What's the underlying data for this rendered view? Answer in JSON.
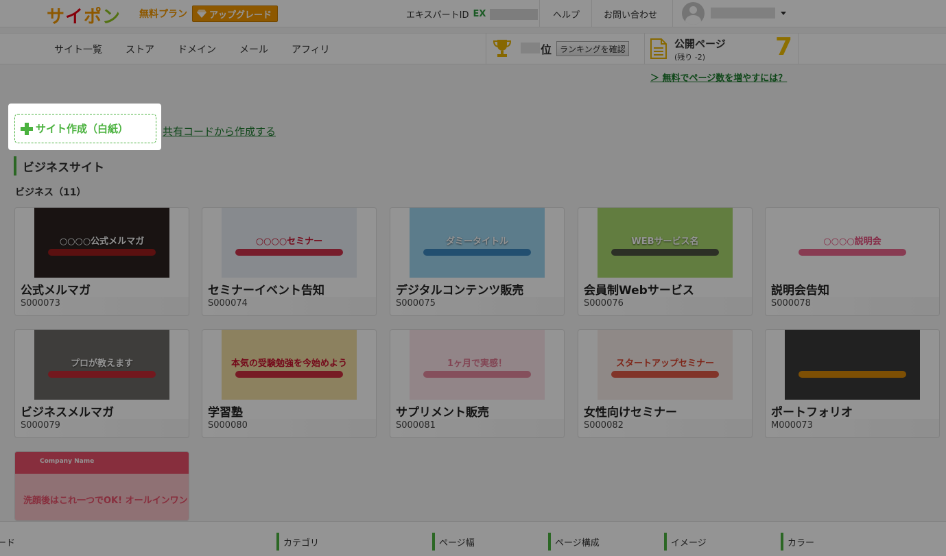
{
  "header": {
    "logo_parts": [
      "サ",
      "イ",
      "ポ",
      "ン"
    ],
    "plan": "無料プラン",
    "upgrade_label": "アップグレード",
    "expert_label": "エキスパートID",
    "expert_prefix": "EX",
    "help": "ヘルプ",
    "contact": "お問い合わせ"
  },
  "nav": {
    "items": [
      "サイト一覧",
      "ストア",
      "ドメイン",
      "メール",
      "アフィリ"
    ]
  },
  "ranking": {
    "suffix": "位",
    "button": "ランキングを確認"
  },
  "public_pages": {
    "title": "公開ページ",
    "remaining": "(残り -2)",
    "count": "7",
    "increase_link": "＞ 無料でページ数を増やすには？"
  },
  "create": {
    "blank_button": "サイト作成（白紙）",
    "shared_link": "共有コードから作成する"
  },
  "section": {
    "title": "ビジネスサイト",
    "category": "ビジネス（11）"
  },
  "templates": [
    {
      "name": "公式メルマガ",
      "code": "S000073",
      "thumb_text": "○○○○公式メルマガ",
      "bg": "#2b2220",
      "accent": "#b21c1c"
    },
    {
      "name": "セミナーイベント告知",
      "code": "S000074",
      "thumb_text": "○○○○セミナー",
      "bg": "#e9eef4",
      "accent": "#c8102e"
    },
    {
      "name": "デジタルコンテンツ販売",
      "code": "S000075",
      "thumb_text": "ダミータイトル",
      "bg": "#9fd6f0",
      "accent": "#2a7ab8"
    },
    {
      "name": "会員制Webサービス",
      "code": "S000076",
      "thumb_text": "WEBサービス名",
      "bg": "#a9d86e",
      "accent": "#3c3c3c"
    },
    {
      "name": "説明会告知",
      "code": "S000078",
      "thumb_text": "○○○○説明会",
      "bg": "#ffffff",
      "accent": "#e64b7a"
    },
    {
      "name": "ビジネスメルマガ",
      "code": "S000079",
      "thumb_text": "プロが教えます",
      "bg": "#6c6a66",
      "accent": "#d71f2b"
    },
    {
      "name": "学習塾",
      "code": "S000080",
      "thumb_text": "本気の受験勉強を今始めよう",
      "bg": "#f1dfa4",
      "accent": "#c8102e"
    },
    {
      "name": "サプリメント販売",
      "code": "S000081",
      "thumb_text": "1ヶ月で実感！",
      "bg": "#fbe6ea",
      "accent": "#e07892"
    },
    {
      "name": "女性向けセミナー",
      "code": "S000082",
      "thumb_text": "スタートアップセミナー",
      "bg": "#f6ece8",
      "accent": "#d9412b"
    },
    {
      "name": "ポートフォリオ",
      "code": "M000073",
      "thumb_text": "",
      "bg": "#3a3a3a",
      "accent": "#f39800"
    },
    {
      "name": "",
      "code": "",
      "thumb_text": "洗顔後はこれ一つでOK! オールインワン",
      "bg": "#f7c3c8",
      "accent": "#e8506a",
      "brand": "Company Name"
    }
  ],
  "filters": [
    "ード",
    "カテゴリ",
    "ページ幅",
    "ページ構成",
    "イメージ",
    "カラー"
  ],
  "colors": {
    "brand_green": "#4bb23f",
    "link_green": "#1a7a2c",
    "upgrade_orange": "#f39800",
    "count_yellow": "#f3c000"
  }
}
